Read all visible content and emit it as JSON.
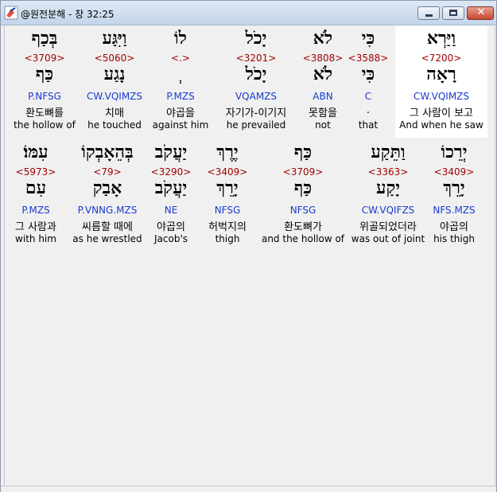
{
  "window": {
    "title": "@원전분해 - 창 32:25",
    "icons": {
      "app": "hebrew-analysis-app-icon",
      "minimize": "minimize-icon",
      "maximize": "maximize-icon",
      "close": "close-icon"
    },
    "close_glyph": "✕"
  },
  "rows": [
    [
      {
        "heb": "וַיַּרְא",
        "num": "<7200>",
        "lemma": "רָאָה",
        "code": "CW.VQIMZS",
        "kor": "그 사람이 보고",
        "eng": "And when he saw",
        "highlighted": true
      },
      {
        "heb": "כִּי",
        "num": "<3588>",
        "lemma": "כִּי",
        "code": "C",
        "kor": ".",
        "eng": "that"
      },
      {
        "heb": "לֹא",
        "num": "<3808>",
        "lemma": "לֹא",
        "code": "ABN",
        "kor": "못함을",
        "eng": "not"
      },
      {
        "heb": "יָכֹל",
        "num": "<3201>",
        "lemma": "יָכֹל",
        "code": "VQAMZS",
        "kor": "자기가-이기지",
        "eng": "he prevailed"
      },
      {
        "heb": "לוֹ",
        "num": "<.>",
        "lemma": "ְ",
        "code": "P.MZS",
        "kor": "야곱을",
        "eng": "against him"
      },
      {
        "heb": "וַיִּגַּע",
        "num": "<5060>",
        "lemma": "נָגַע",
        "code": "CW.VQIMZS",
        "kor": "치매",
        "eng": "he touched"
      },
      {
        "heb": "בְּכַף",
        "num": "<3709>",
        "lemma": "כַּף",
        "code": "P.NFSG",
        "kor": "환도뼈를",
        "eng": "the hollow of"
      }
    ],
    [
      {
        "heb": "יְרֵכוֹ",
        "num": "<3409>",
        "lemma": "יָרֵךְ",
        "code": "NFS.MZS",
        "kor": "야곱의",
        "eng": "his thigh"
      },
      {
        "heb": "וַתֵּקַע",
        "num": "<3363>",
        "lemma": "יָקַע",
        "code": "CW.VQIFZS",
        "kor": "위골되었더라",
        "eng": "was out of joint"
      },
      {
        "heb": "כַּף",
        "num": "<3709>",
        "lemma": "כַּף",
        "code": "NFSG",
        "kor": "환도뼈가",
        "eng": "and the hollow of"
      },
      {
        "heb": "יֶרֶךְ",
        "num": "<3409>",
        "lemma": "יָרֵךְ",
        "code": "NFSG",
        "kor": "허벅지의",
        "eng": "thigh"
      },
      {
        "heb": "יַעֲקֹב",
        "num": "<3290>",
        "lemma": "יַעֲקֹב",
        "code": "NE",
        "kor": "야곱의",
        "eng": "Jacob's"
      },
      {
        "heb": "בְּהֵאָבְקוֹ",
        "num": "<79>",
        "lemma": "אָבַק",
        "code": "P.VNNG.MZS",
        "kor": "씨름할 때에",
        "eng": "as he wrestled"
      },
      {
        "heb": "עִמּוֹ׃",
        "num": "<5973>",
        "lemma": "עִם",
        "code": "P.MZS",
        "kor": "그 사람과",
        "eng": "with him"
      }
    ]
  ]
}
